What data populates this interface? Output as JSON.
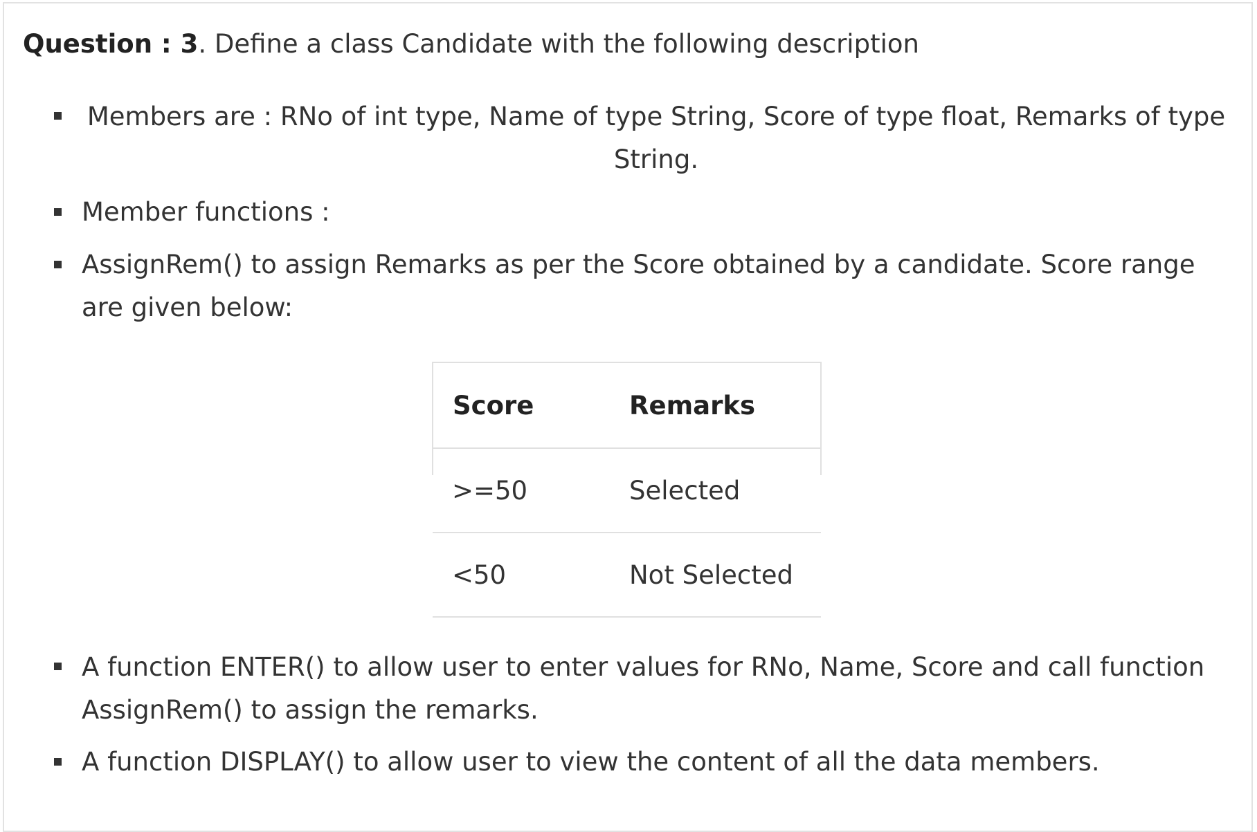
{
  "question": {
    "label": "Question : 3",
    "text": ". Define a class Candidate with the following description"
  },
  "items": [
    {
      "line1": "Members are : RNo of int type, Name of type String, Score of type float, Remarks of type",
      "line2": "String."
    },
    {
      "line1": "Member functions :"
    },
    {
      "line1": "AssignRem() to assign Remarks as per the Score obtained by a candidate. Score range",
      "line2": "are given below:"
    },
    {
      "line1": "A function ENTER() to allow user to enter values for RNo, Name, Score and call function",
      "line2": "AssignRem() to assign the remarks."
    },
    {
      "line1": "A function DISPLAY() to allow user to view the content of all the data members."
    }
  ],
  "table": {
    "headers": [
      "Score",
      "Remarks"
    ],
    "rows": [
      [
        ">=50",
        "Selected"
      ],
      [
        "<50",
        "Not Selected"
      ]
    ]
  }
}
